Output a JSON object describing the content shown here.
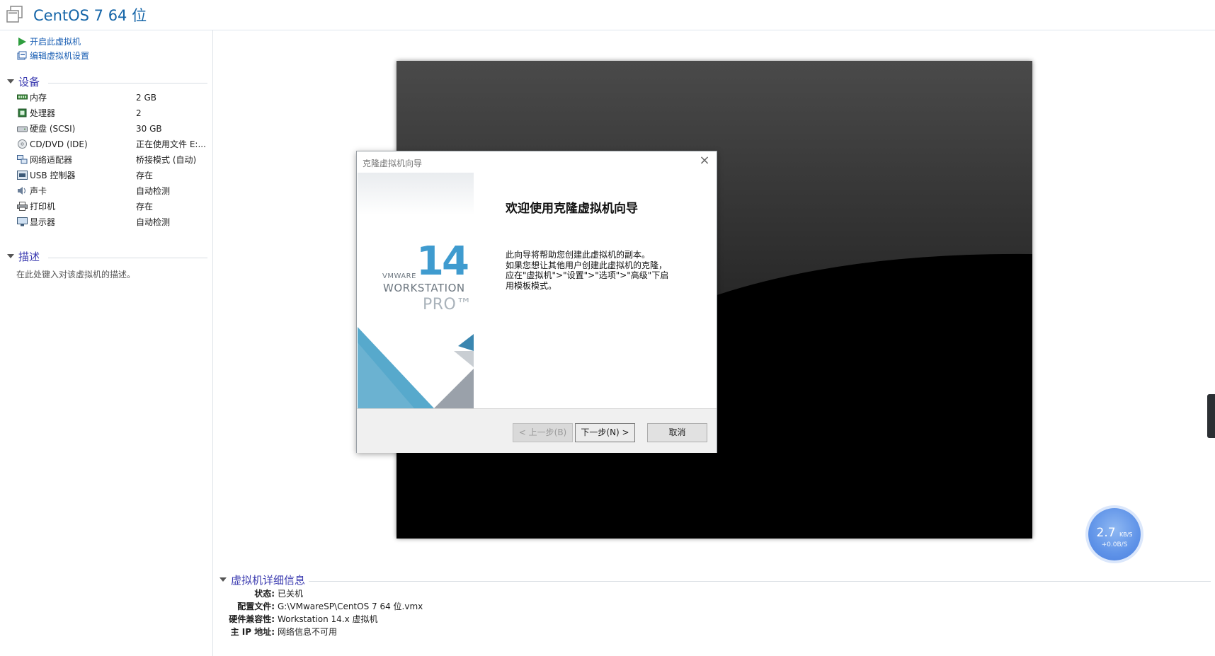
{
  "window": {
    "title": "CentOS 7 64 位"
  },
  "actions": [
    {
      "label": "开启此虚拟机",
      "icon": "play-icon"
    },
    {
      "label": "编辑虚拟机设置",
      "icon": "edit-settings-icon"
    }
  ],
  "devices_section": {
    "title": "设备",
    "items": [
      {
        "name": "内存",
        "value": "2 GB",
        "icon": "memory-icon"
      },
      {
        "name": "处理器",
        "value": "2",
        "icon": "processor-icon"
      },
      {
        "name": "硬盘 (SCSI)",
        "value": "30 GB",
        "icon": "harddisk-icon"
      },
      {
        "name": "CD/DVD (IDE)",
        "value": "正在使用文件 E:...",
        "icon": "cd-dvd-icon"
      },
      {
        "name": "网络适配器",
        "value": "桥接模式 (自动)",
        "icon": "network-adapter-icon"
      },
      {
        "name": "USB 控制器",
        "value": "存在",
        "icon": "usb-icon"
      },
      {
        "name": "声卡",
        "value": "自动检测",
        "icon": "sound-icon"
      },
      {
        "name": "打印机",
        "value": "存在",
        "icon": "printer-icon"
      },
      {
        "name": "显示器",
        "value": "自动检测",
        "icon": "display-icon"
      }
    ]
  },
  "description_section": {
    "title": "描述",
    "placeholder": "在此处键入对该虚拟机的描述。"
  },
  "dialog": {
    "title": "克隆虚拟机向导",
    "banner": {
      "number": "14",
      "brand": "VMWARE",
      "product": "WORKSTATION",
      "edition": "PRO™"
    },
    "heading": "欢迎使用克隆虚拟机向导",
    "body_lines": [
      "此向导将帮助您创建此虚拟机的副本。",
      "如果您想让其他用户创建此虚拟机的克隆，",
      "应在\"虚拟机\">\"设置\">\"选项\">\"高级\"下启",
      "用模板模式。"
    ],
    "buttons": {
      "back": "< 上一步(B)",
      "next": "下一步(N) >",
      "cancel": "取消"
    }
  },
  "details_section": {
    "title": "虚拟机详细信息",
    "rows": [
      {
        "key": "状态:",
        "value": "已关机"
      },
      {
        "key": "配置文件:",
        "value": "G:\\VMwareSP\\CentOS 7 64 位.vmx"
      },
      {
        "key": "硬件兼容性:",
        "value": "Workstation 14.x 虚拟机"
      },
      {
        "key": "主 IP 地址:",
        "value": "网络信息不可用"
      }
    ]
  },
  "net_widget": {
    "speed": "2.7",
    "unit": "KB/S",
    "upload": "+0.0B/S"
  }
}
